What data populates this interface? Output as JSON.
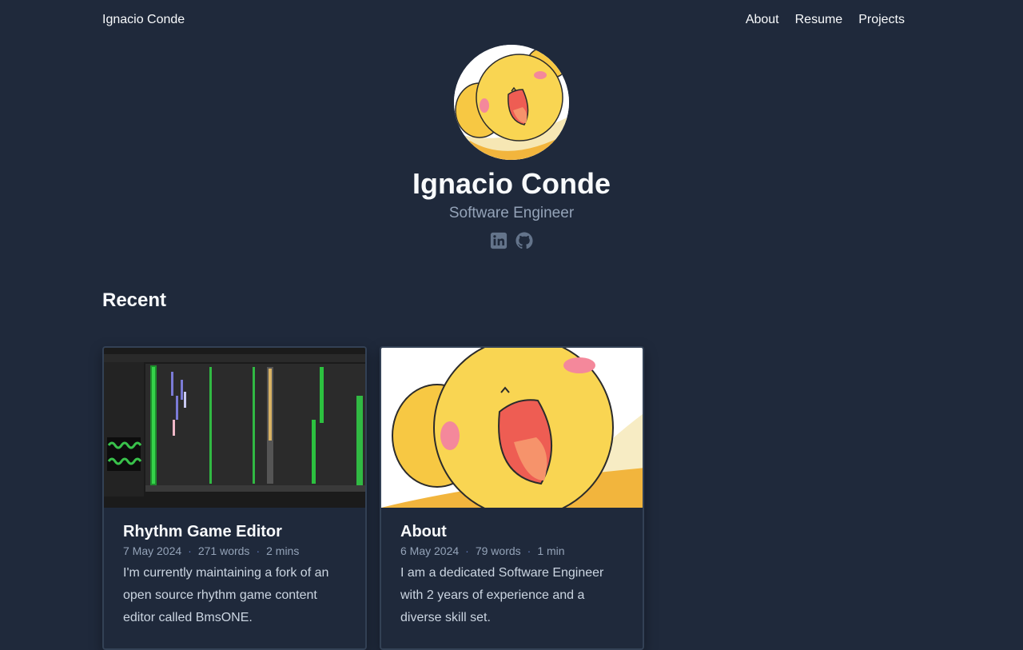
{
  "header": {
    "brand": "Ignacio Conde",
    "nav": [
      "About",
      "Resume",
      "Projects"
    ]
  },
  "hero": {
    "name": "Ignacio Conde",
    "role": "Software Engineer",
    "socials": [
      "linkedin-icon",
      "github-icon"
    ]
  },
  "recent": {
    "title": "Recent",
    "cards": [
      {
        "title": "Rhythm Game Editor",
        "date": "7 May 2024",
        "words": "271 words",
        "reading": "2 mins",
        "summary": "I'm currently maintaining a fork of an open source rhythm game content editor called BmsONE."
      },
      {
        "title": "About",
        "date": "6 May 2024",
        "words": "79 words",
        "reading": "1 min",
        "summary": "I am a dedicated Software Engineer with 2 years of experience and a diverse skill set."
      }
    ]
  },
  "colors": {
    "background": "#1f293b",
    "muted_text": "#94a3b8",
    "meta_dot": "#6178b8",
    "card_border": "#334155"
  }
}
